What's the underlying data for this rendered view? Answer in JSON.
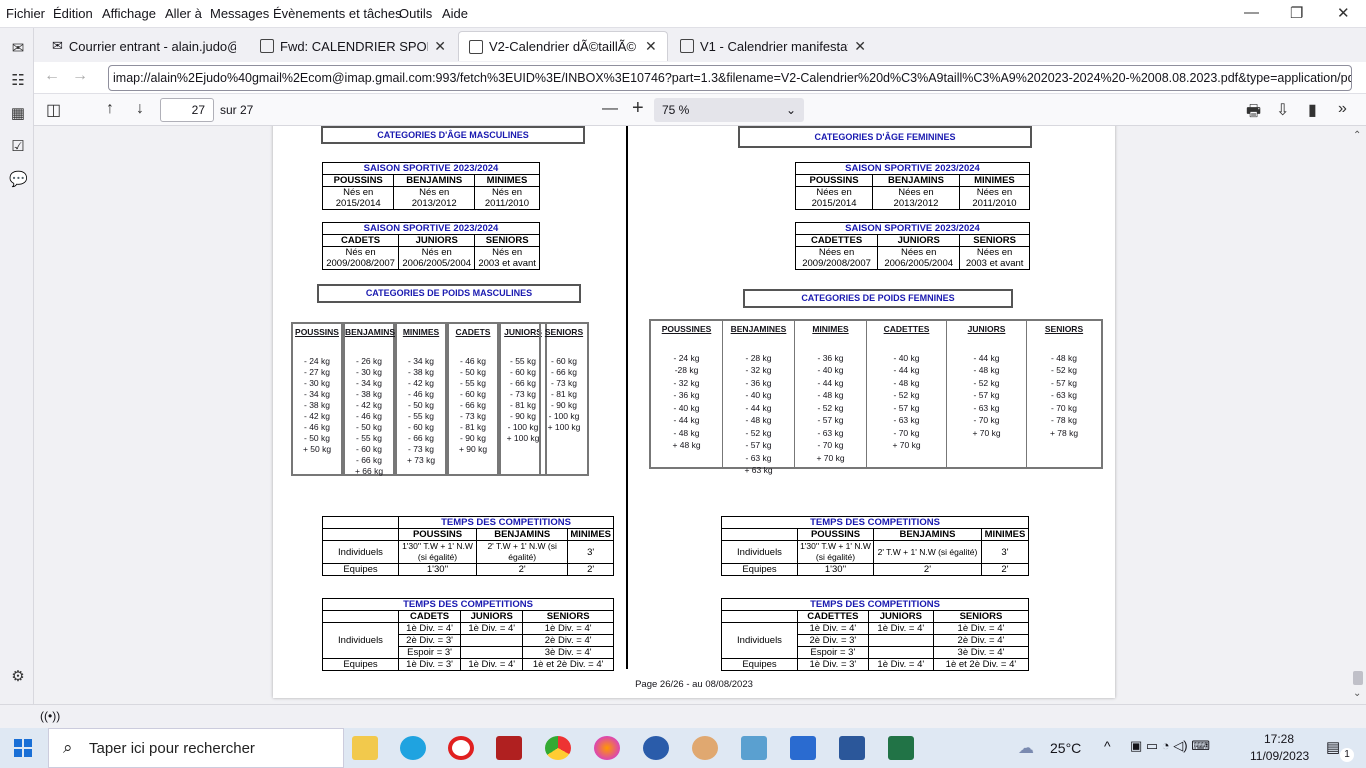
{
  "menu": [
    "Fichier",
    "Édition",
    "Affichage",
    "Aller à",
    "Messages",
    "Évènements et tâches",
    "Outils",
    "Aide"
  ],
  "window_controls": [
    "—",
    "❐",
    "✕"
  ],
  "tabs": [
    {
      "label": "Courrier entrant - alain.judo@gm",
      "icon": "mail-icon"
    },
    {
      "label": "Fwd: CALENDRIER SPORTIF S",
      "icon": "message-icon"
    },
    {
      "label": "V2-Calendrier dÃ©taillÃ© 2",
      "icon": "pdf-icon"
    },
    {
      "label": "V1 - Calendrier manifestatio",
      "icon": "pdf-icon"
    }
  ],
  "nav": {
    "back": "←",
    "forward": "→",
    "url": "imap://alain%2Ejudo%40gmail%2Ecom@imap.gmail.com:993/fetch%3EUID%3E/INBOX%3E10746?part=1.3&filename=V2-Calendrier%20d%C3%A9taill%C3%A9%202023-2024%20-%2008.08.2023.pdf&type=application/pdf"
  },
  "pdf_toolbar": {
    "page": "27",
    "of_label": "sur 27",
    "zoom": "75 %",
    "minus": "—",
    "plus": "+"
  },
  "pdf": {
    "masc_title": "CATEGORIES D'ÂGE MASCULINES",
    "fem_title": "CATEGORIES D'ÂGE FEMININES",
    "season": "SAISON SPORTIVE 2023/2024",
    "masc_age1": {
      "heads": [
        "POUSSINS",
        "BENJAMINS",
        "MINIMES"
      ],
      "cells": [
        [
          "Nés en",
          "2015/2014"
        ],
        [
          "Nés en",
          "2013/2012"
        ],
        [
          "Nés en",
          "2011/2010"
        ]
      ]
    },
    "masc_age2": {
      "heads": [
        "CADETS",
        "JUNIORS",
        "SENIORS"
      ],
      "cells": [
        [
          "Nés en",
          "2009/2008/2007"
        ],
        [
          "Nés en",
          "2006/2005/2004"
        ],
        [
          "Nés en",
          "2003 et avant"
        ]
      ]
    },
    "fem_age1": {
      "heads": [
        "POUSSINS",
        "BENJAMINS",
        "MINIMES"
      ],
      "cells": [
        [
          "Nées en",
          "2015/2014"
        ],
        [
          "Nées en",
          "2013/2012"
        ],
        [
          "Nées en",
          "2011/2010"
        ]
      ]
    },
    "fem_age2": {
      "heads": [
        "CADETTES",
        "JUNIORS",
        "SENIORS"
      ],
      "cells": [
        [
          "Nées en",
          "2009/2008/2007"
        ],
        [
          "Nées en",
          "2006/2005/2004"
        ],
        [
          "Nées en",
          "2003 et avant"
        ]
      ]
    },
    "masc_weight_title": "CATEGORIES DE POIDS MASCULINES",
    "fem_weight_title": "CATEGORIES DE POIDS FEMNINES",
    "masc_weights": [
      {
        "h": "POUSSINS",
        "v": [
          "- 24 kg",
          "- 27 kg",
          "- 30 kg",
          "- 34 kg",
          "- 38 kg",
          "- 42 kg",
          "- 46 kg",
          "- 50 kg",
          "+ 50 kg"
        ]
      },
      {
        "h": "BENJAMINS",
        "v": [
          "- 26 kg",
          "- 30 kg",
          "- 34 kg",
          "- 38 kg",
          "- 42 kg",
          "- 46 kg",
          "- 50 kg",
          "- 55 kg",
          "- 60 kg",
          "- 66 kg",
          "+ 66 kg"
        ]
      },
      {
        "h": "MINIMES",
        "v": [
          "- 34 kg",
          "- 38 kg",
          "- 42 kg",
          "- 46 kg",
          "- 50 kg",
          "- 55 kg",
          "- 60 kg",
          "- 66 kg",
          "- 73 kg",
          "+ 73 kg"
        ]
      },
      {
        "h": "CADETS",
        "v": [
          "- 46 kg",
          "- 50 kg",
          "- 55 kg",
          "- 60 kg",
          "- 66 kg",
          "- 73 kg",
          "- 81 kg",
          "- 90 kg",
          "+ 90 kg"
        ]
      },
      {
        "h": "JUNIORS",
        "v": [
          "- 55 kg",
          "- 60 kg",
          "- 66 kg",
          "- 73 kg",
          "- 81 kg",
          "- 90 kg",
          "- 100 kg",
          "+ 100 kg"
        ]
      },
      {
        "h": "SENIORS",
        "v": [
          "- 60 kg",
          "- 66 kg",
          "- 73 kg",
          "- 81 kg",
          "- 90 kg",
          "- 100 kg",
          "+ 100 kg"
        ]
      }
    ],
    "fem_weights": [
      {
        "h": "POUSSINES",
        "v": [
          "- 24 kg",
          "-28 kg",
          "- 32 kg",
          "- 36 kg",
          "- 40 kg",
          "- 44 kg",
          "- 48 kg",
          "+ 48 kg"
        ]
      },
      {
        "h": "BENJAMINES",
        "v": [
          "- 28 kg",
          "- 32 kg",
          "- 36 kg",
          "- 40 kg",
          "- 44 kg",
          "- 48 kg",
          "- 52 kg",
          "- 57 kg",
          "- 63 kg",
          "+ 63 kg"
        ]
      },
      {
        "h": "MINIMES",
        "v": [
          "- 36 kg",
          "- 40 kg",
          "- 44 kg",
          "- 48 kg",
          "- 52 kg",
          "- 57 kg",
          "- 63 kg",
          "- 70 kg",
          "+ 70 kg"
        ]
      },
      {
        "h": "CADETTES",
        "v": [
          "- 40 kg",
          "- 44 kg",
          "- 48 kg",
          "- 52 kg",
          "- 57 kg",
          "- 63 kg",
          "- 70 kg",
          "+ 70 kg"
        ]
      },
      {
        "h": "JUNIORS",
        "v": [
          "- 44 kg",
          "- 48 kg",
          "- 52 kg",
          "- 57 kg",
          "- 63 kg",
          "- 70 kg",
          "+ 70 kg"
        ]
      },
      {
        "h": "SENIORS",
        "v": [
          "- 48 kg",
          "- 52 kg",
          "- 57 kg",
          "- 63 kg",
          "- 70 kg",
          "- 78 kg",
          "+ 78 kg"
        ]
      }
    ],
    "time_title": "TEMPS DES COMPETITIONS",
    "time1": {
      "heads": [
        "POUSSINS",
        "BENJAMINS",
        "MINIMES"
      ],
      "rows": [
        {
          "label": "Individuels",
          "cells": [
            "1'30'' T.W + 1' N.W (si égalité)",
            "2' T.W + 1' N.W (si égalité)",
            "3'"
          ]
        },
        {
          "label": "Equipes",
          "cells": [
            "1'30''",
            "2'",
            "2'"
          ]
        }
      ]
    },
    "time2": {
      "heads": [
        "CADETS",
        "JUNIORS",
        "SENIORS"
      ],
      "ind": "Individuels",
      "eq": "Equipes",
      "rows": [
        [
          "1è Div. = 4'",
          "1è Div. = 4'",
          "1è Div. = 4'"
        ],
        [
          "2è Div. = 3'",
          "",
          "2è Div. = 4'"
        ],
        [
          "Espoir = 3'",
          "",
          "3è Div. = 4'"
        ],
        [
          "1è Div. = 3'",
          "1è Div. = 4'",
          "1è et 2è Div. = 4'"
        ]
      ]
    },
    "time2f_heads": [
      "CADETTES",
      "JUNIORS",
      "SENIORS"
    ],
    "footer": "Page 26/26  -  au 08/08/2023"
  },
  "taskbar": {
    "search_placeholder": "Taper ici pour rechercher",
    "weather": "25°C",
    "time": "17:28",
    "date": "11/09/2023",
    "notif": "1"
  }
}
